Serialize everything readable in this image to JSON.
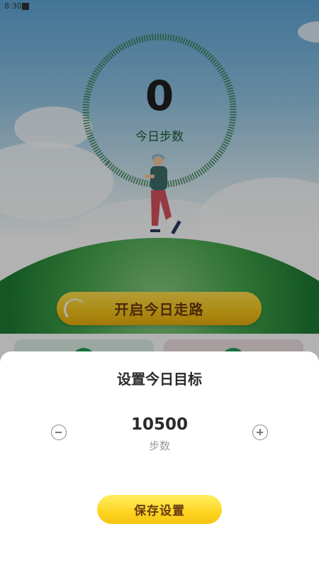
{
  "status_bar": {
    "time": "8:30"
  },
  "dashboard": {
    "steps_today": "0",
    "steps_label": "今日步数",
    "start_walk_label": "开启今日走路"
  },
  "goal_sheet": {
    "title": "设置今日目标",
    "goal_value": "10500",
    "goal_unit": "步数",
    "save_label": "保存设置"
  },
  "colors": {
    "accent_yellow": "#f6c51a",
    "grass_green": "#1e7d34",
    "button_text": "#6a3a12"
  },
  "icons": {
    "minus": "minus-circle-icon",
    "plus": "plus-circle-icon"
  }
}
